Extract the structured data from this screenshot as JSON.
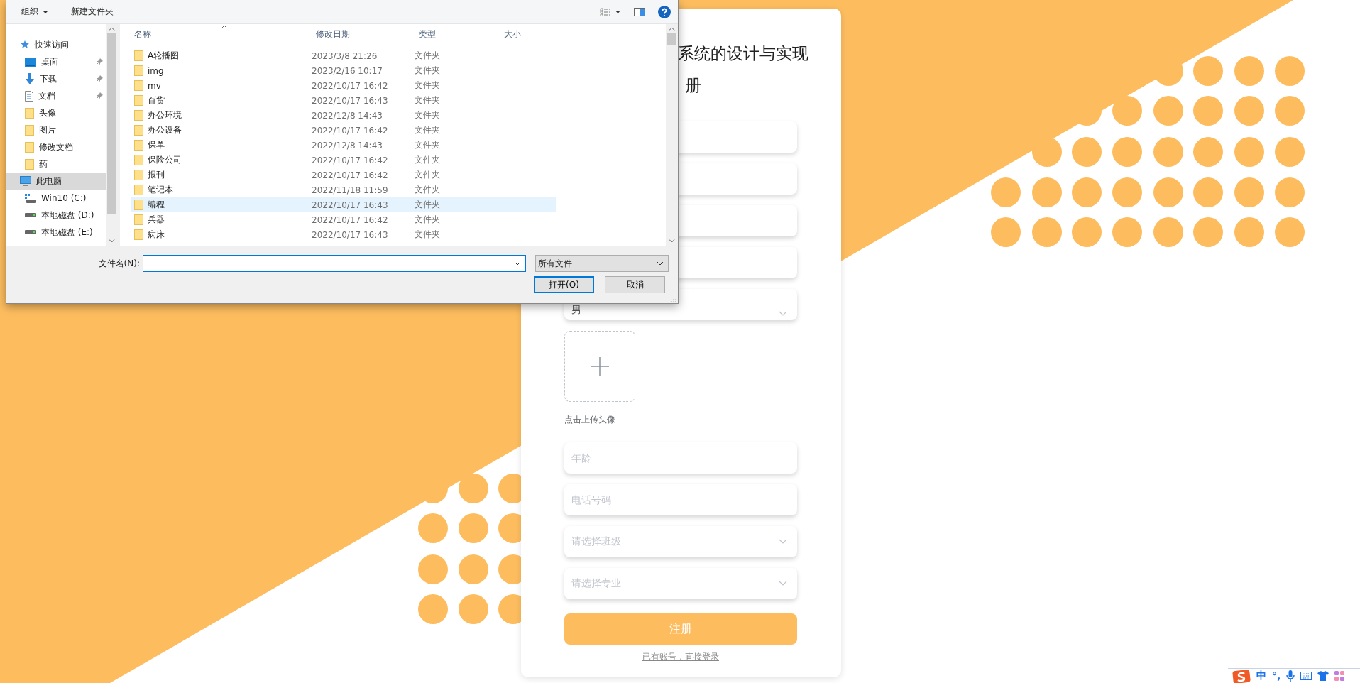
{
  "page": {
    "title_lines": [
      "系统的设计与实现",
      "册"
    ],
    "fields": [
      {
        "kind": "input"
      },
      {
        "kind": "input"
      },
      {
        "kind": "input"
      },
      {
        "kind": "input"
      },
      {
        "kind": "select",
        "value": "男"
      }
    ],
    "upload": {
      "caption": "点击上传头像"
    },
    "fields_after": [
      {
        "kind": "input",
        "placeholder": "年龄"
      },
      {
        "kind": "input",
        "placeholder": "电话号码"
      },
      {
        "kind": "select",
        "placeholder": "请选择班级"
      },
      {
        "kind": "select",
        "placeholder": "请选择专业"
      }
    ],
    "submit": "注册",
    "login_link": "已有账号，直接登录"
  },
  "file_dialog": {
    "toolbar": [
      {
        "label": "组织",
        "dropdown": true
      },
      {
        "label": "新建文件夹",
        "dropdown": false
      }
    ],
    "nav": [
      {
        "label": "快速访问",
        "kind": "star",
        "selected": false,
        "children": [
          {
            "label": "桌面",
            "kind": "desktop",
            "pinned": true,
            "selected": false
          },
          {
            "label": "下载",
            "kind": "download",
            "pinned": true,
            "selected": false
          },
          {
            "label": "文档",
            "kind": "document",
            "pinned": true,
            "selected": false
          },
          {
            "label": "头像",
            "kind": "folder",
            "pinned": false,
            "selected": false
          },
          {
            "label": "图片",
            "kind": "folder",
            "pinned": false,
            "selected": false
          },
          {
            "label": "修改文档",
            "kind": "folder",
            "pinned": false,
            "selected": false
          },
          {
            "label": "药",
            "kind": "folder",
            "pinned": false,
            "selected": false
          }
        ]
      },
      {
        "label": "此电脑",
        "kind": "computer",
        "selected": true,
        "children": [
          {
            "label": "Win10 (C:)",
            "kind": "system_drive",
            "selected": false
          },
          {
            "label": "本地磁盘 (D:)",
            "kind": "drive",
            "selected": false
          },
          {
            "label": "本地磁盘 (E:)",
            "kind": "drive",
            "selected": false
          }
        ]
      }
    ],
    "columns": [
      "名称",
      "修改日期",
      "类型",
      "大小"
    ],
    "rows": [
      {
        "name": "A轮播图",
        "date": "2023/3/8 21:26",
        "type": "文件夹",
        "selected": false
      },
      {
        "name": "img",
        "date": "2023/2/16 10:17",
        "type": "文件夹",
        "selected": false
      },
      {
        "name": "mv",
        "date": "2022/10/17 16:42",
        "type": "文件夹",
        "selected": false
      },
      {
        "name": "百货",
        "date": "2022/10/17 16:43",
        "type": "文件夹",
        "selected": false
      },
      {
        "name": "办公环境",
        "date": "2022/12/8 14:43",
        "type": "文件夹",
        "selected": false
      },
      {
        "name": "办公设备",
        "date": "2022/10/17 16:42",
        "type": "文件夹",
        "selected": false
      },
      {
        "name": "保单",
        "date": "2022/12/8 14:43",
        "type": "文件夹",
        "selected": false
      },
      {
        "name": "保险公司",
        "date": "2022/10/17 16:42",
        "type": "文件夹",
        "selected": false
      },
      {
        "name": "报刊",
        "date": "2022/10/17 16:42",
        "type": "文件夹",
        "selected": false
      },
      {
        "name": "笔记本",
        "date": "2022/11/18 11:59",
        "type": "文件夹",
        "selected": false
      },
      {
        "name": "编程",
        "date": "2022/10/17 16:43",
        "type": "文件夹",
        "selected": true
      },
      {
        "name": "兵器",
        "date": "2022/10/17 16:42",
        "type": "文件夹",
        "selected": false
      },
      {
        "name": "病床",
        "date": "2022/10/17 16:43",
        "type": "文件夹",
        "selected": false
      }
    ],
    "filename_label": "文件名(N):",
    "filter": "所有文件",
    "buttons": [
      {
        "label": "打开(O)",
        "default": true
      },
      {
        "label": "取消",
        "default": false
      }
    ]
  },
  "ime_bar": {
    "mode": "中",
    "punctuation": "°,"
  }
}
